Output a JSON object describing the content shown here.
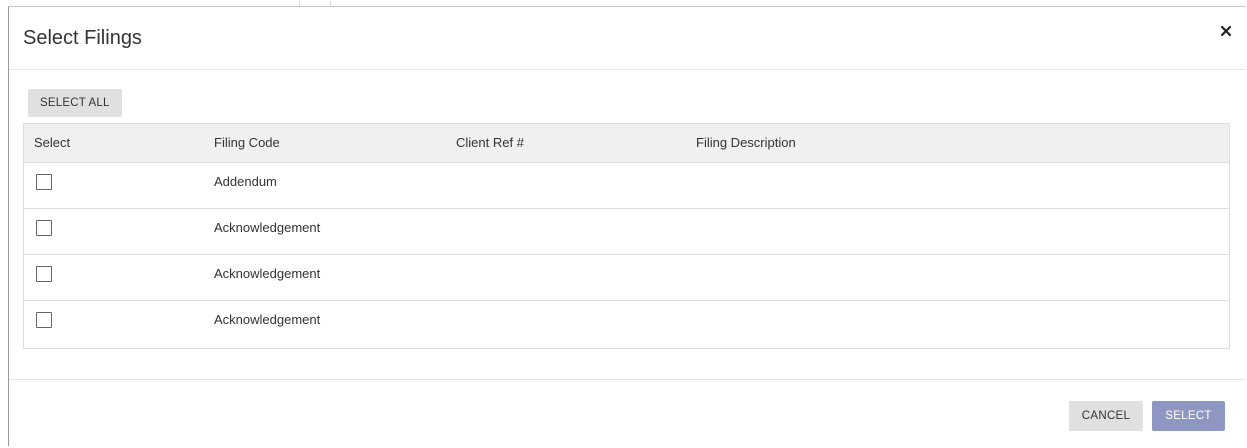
{
  "modal": {
    "title": "Select Filings",
    "close_icon": "close-icon"
  },
  "toolbar": {
    "select_all_label": "SELECT ALL"
  },
  "table": {
    "headers": [
      "Select",
      "Filing Code",
      "Client Ref #",
      "Filing Description"
    ],
    "rows": [
      {
        "checked": false,
        "filing_code": "Addendum",
        "client_ref": "",
        "description": ""
      },
      {
        "checked": false,
        "filing_code": "Acknowledgement",
        "client_ref": "",
        "description": ""
      },
      {
        "checked": false,
        "filing_code": "Acknowledgement",
        "client_ref": "",
        "description": ""
      },
      {
        "checked": false,
        "filing_code": "Acknowledgement",
        "client_ref": "",
        "description": ""
      }
    ]
  },
  "footer": {
    "cancel_label": "CANCEL",
    "select_label": "SELECT"
  },
  "colors": {
    "select_button_bg": "#8e97c2",
    "header_row_bg": "#f0f0f0",
    "secondary_button_bg": "#e0e0e0"
  }
}
